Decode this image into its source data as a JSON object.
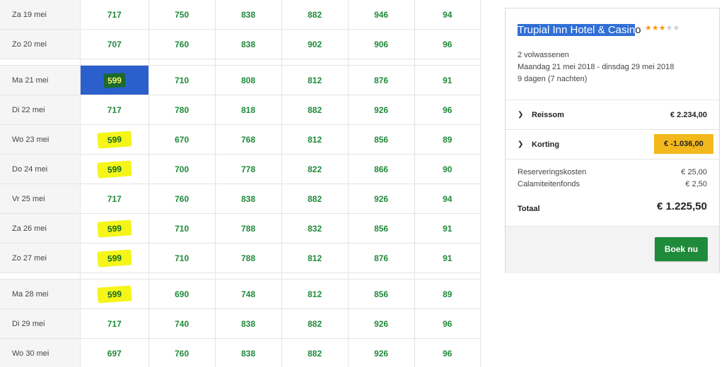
{
  "grid": {
    "rows": [
      {
        "date": "Za 19 mei",
        "prices": [
          "717",
          "750",
          "838",
          "882",
          "946",
          "94"
        ]
      },
      {
        "date": "Zo 20 mei",
        "prices": [
          "707",
          "760",
          "838",
          "902",
          "906",
          "96"
        ]
      },
      {
        "date": "Ma 21 mei",
        "prices": [
          "599",
          "710",
          "808",
          "812",
          "876",
          "91"
        ]
      },
      {
        "date": "Di 22 mei",
        "prices": [
          "717",
          "780",
          "818",
          "882",
          "926",
          "96"
        ]
      },
      {
        "date": "Wo 23 mei",
        "prices": [
          "599",
          "670",
          "768",
          "812",
          "856",
          "89"
        ]
      },
      {
        "date": "Do 24 mei",
        "prices": [
          "599",
          "700",
          "778",
          "822",
          "866",
          "90"
        ]
      },
      {
        "date": "Vr 25 mei",
        "prices": [
          "717",
          "760",
          "838",
          "882",
          "926",
          "94"
        ]
      },
      {
        "date": "Za 26 mei",
        "prices": [
          "599",
          "710",
          "788",
          "832",
          "856",
          "91"
        ]
      },
      {
        "date": "Zo 27 mei",
        "prices": [
          "599",
          "710",
          "788",
          "812",
          "876",
          "91"
        ]
      },
      {
        "date": "Ma 28 mei",
        "prices": [
          "599",
          "690",
          "748",
          "812",
          "856",
          "89"
        ]
      },
      {
        "date": "Di 29 mei",
        "prices": [
          "717",
          "740",
          "838",
          "882",
          "926",
          "96"
        ]
      },
      {
        "date": "Wo 30 mei",
        "prices": [
          "697",
          "760",
          "838",
          "882",
          "926",
          "96"
        ]
      }
    ]
  },
  "panel": {
    "hotel_name_selected": "Trupial Inn Hotel & Casin",
    "hotel_name_rest": "o",
    "stars_filled": 3,
    "stars_total": 5,
    "guests": "2 volwassenen",
    "dates": "Maandag 21 mei 2018 - dinsdag 29 mei 2018",
    "duration": "9 dagen (7 nachten)",
    "reissom_label": "Reissom",
    "reissom_value": "€ 2.234,00",
    "korting_label": "Korting",
    "korting_value": "€ -1.036,00",
    "reservering_label": "Reserveringskosten",
    "reservering_value": "€ 25,00",
    "calamiteiten_label": "Calamiteitenfonds",
    "calamiteiten_value": "€ 2,50",
    "totaal_label": "Totaal",
    "totaal_value": "€ 1.225,50",
    "book_button": "Boek nu"
  },
  "colors": {
    "price_green": "#1f8a3a",
    "selected_cell": "#2b5fcb",
    "highlight_yellow": "#f5f51a",
    "discount_orange": "#f3b81b",
    "button_green": "#1f8a3a"
  }
}
